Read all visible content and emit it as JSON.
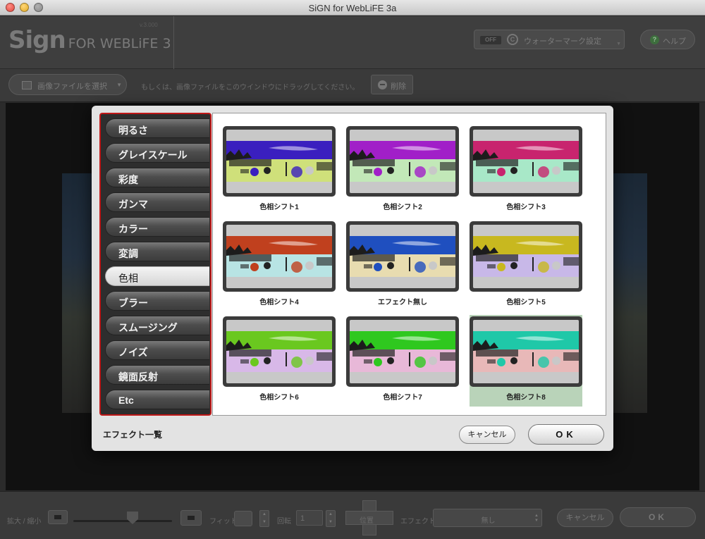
{
  "window": {
    "title": "SiGN for WebLiFE 3a"
  },
  "header": {
    "logo_text": "Sign",
    "logo_sub": "FOR WEBLiFE 3",
    "version": "v.3.000",
    "watermark_toggle": "OFF",
    "watermark_label": "ウォーターマーク設定",
    "help_label": "ヘルプ"
  },
  "toolbar": {
    "select_file_label": "画像ファイルを選択",
    "hint": "もしくは、画像ファイルをこのウインドウにドラッグしてください。",
    "delete_label": "削除"
  },
  "bottombar": {
    "zoom_label": "拡大 / 縮小",
    "fit_label": "フィット",
    "rotate_label": "回転",
    "rotate_value": "1",
    "position_label": "位置",
    "effect_label": "エフェクト",
    "effect_value": "無し",
    "cancel_label": "キャンセル",
    "ok_label": "OK"
  },
  "dialog": {
    "categories": [
      {
        "label": "明るさ"
      },
      {
        "label": "グレイスケール"
      },
      {
        "label": "彩度"
      },
      {
        "label": "ガンマ"
      },
      {
        "label": "カラー"
      },
      {
        "label": "変調"
      },
      {
        "label": "色相"
      },
      {
        "label": "ブラー"
      },
      {
        "label": "スムージング"
      },
      {
        "label": "ノイズ"
      },
      {
        "label": "鏡面反射"
      },
      {
        "label": "Etc"
      }
    ],
    "selected_category": "色相",
    "effects": [
      {
        "label": "色相シフト1",
        "sky": "#3a1fbf",
        "tint": "#cfe07a"
      },
      {
        "label": "色相シフト2",
        "sky": "#a11fc8",
        "tint": "#c2e8b8"
      },
      {
        "label": "色相シフト3",
        "sky": "#c8246e",
        "tint": "#a8e8c8"
      },
      {
        "label": "色相シフト4",
        "sky": "#c0401e",
        "tint": "#b8e4e4"
      },
      {
        "label": "エフェクト無し",
        "sky": "#1f4fbf",
        "tint": "#e8dcb0"
      },
      {
        "label": "色相シフト5",
        "sky": "#c8b81f",
        "tint": "#c8b8e8"
      },
      {
        "label": "色相シフト6",
        "sky": "#6ac81f",
        "tint": "#d8b8e8"
      },
      {
        "label": "色相シフト7",
        "sky": "#2fc81f",
        "tint": "#e8b8d8"
      },
      {
        "label": "色相シフト8",
        "sky": "#1fc8a8",
        "tint": "#e8b8b8"
      }
    ],
    "selected_effect": "色相シフト8",
    "footer_label": "エフェクト一覧",
    "cancel_label": "キャンセル",
    "ok_label": "OK"
  }
}
